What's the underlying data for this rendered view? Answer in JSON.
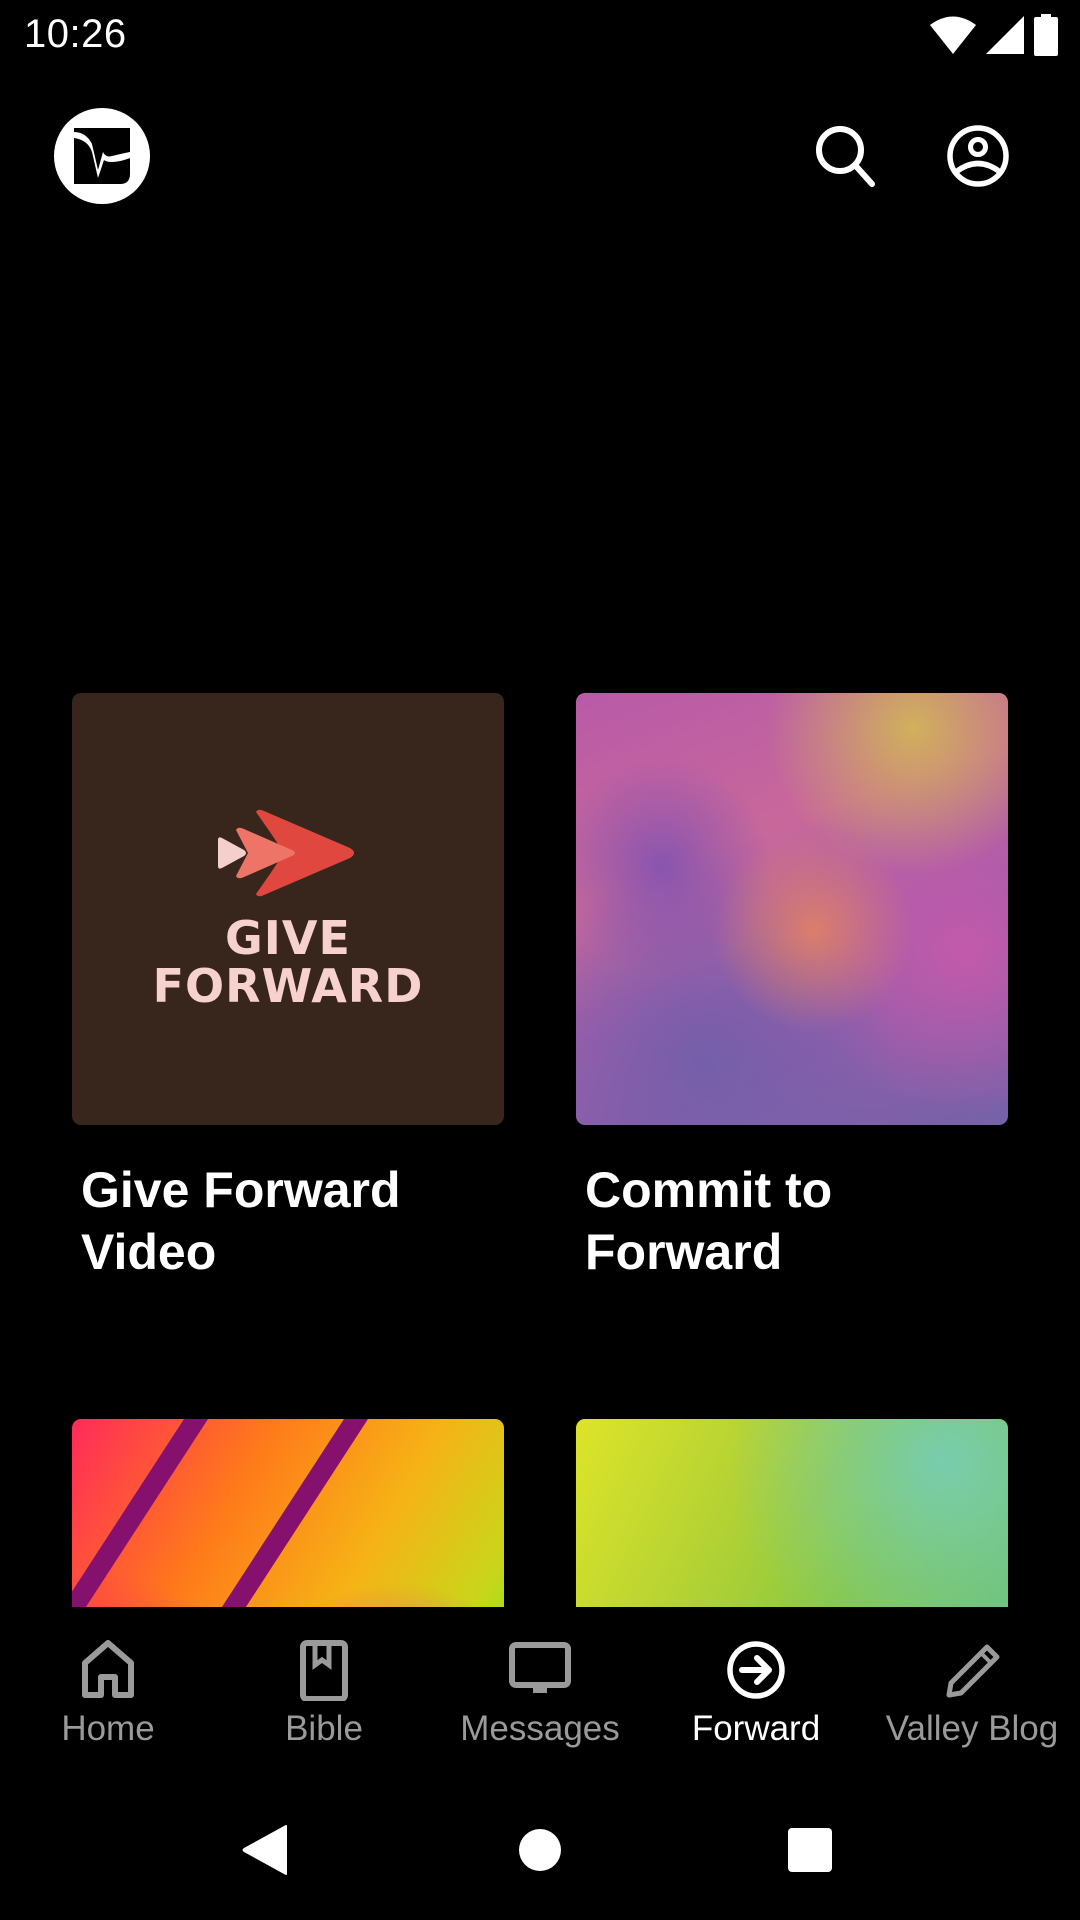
{
  "status_bar": {
    "time": "10:26",
    "icons": [
      "wifi-icon",
      "cellular-signal-icon",
      "battery-icon"
    ]
  },
  "app_bar": {
    "logo": "app-logo",
    "actions": [
      {
        "name": "search",
        "icon": "search-icon"
      },
      {
        "name": "account",
        "icon": "account-circle-icon"
      }
    ]
  },
  "cards": [
    {
      "title": "Give Forward Video",
      "image": "give-forward-logo",
      "image_text": [
        "GIVE",
        "FORWARD"
      ]
    },
    {
      "title": "Commit to Forward",
      "image": "purple-watercolor-artwork"
    },
    {
      "title": "",
      "image": "neon-stripes-artwork"
    },
    {
      "title": "",
      "image": "green-watercolor-artwork"
    }
  ],
  "bottom_nav": {
    "active": "Forward",
    "items": [
      {
        "label": "Home",
        "icon": "home-icon"
      },
      {
        "label": "Bible",
        "icon": "bible-icon"
      },
      {
        "label": "Messages",
        "icon": "tv-icon"
      },
      {
        "label": "Forward",
        "icon": "arrow-circle-right-icon"
      },
      {
        "label": "Valley Blog",
        "icon": "pencil-icon"
      }
    ]
  },
  "system_nav": [
    "back",
    "home",
    "recents"
  ],
  "colors": {
    "background": "#000000",
    "nav_inactive": "#9a9a9a",
    "nav_active": "#ffffff",
    "give_forward_bg": "#38261c",
    "give_forward_text": "#f6d1cd",
    "give_forward_red": "#e0473f"
  }
}
